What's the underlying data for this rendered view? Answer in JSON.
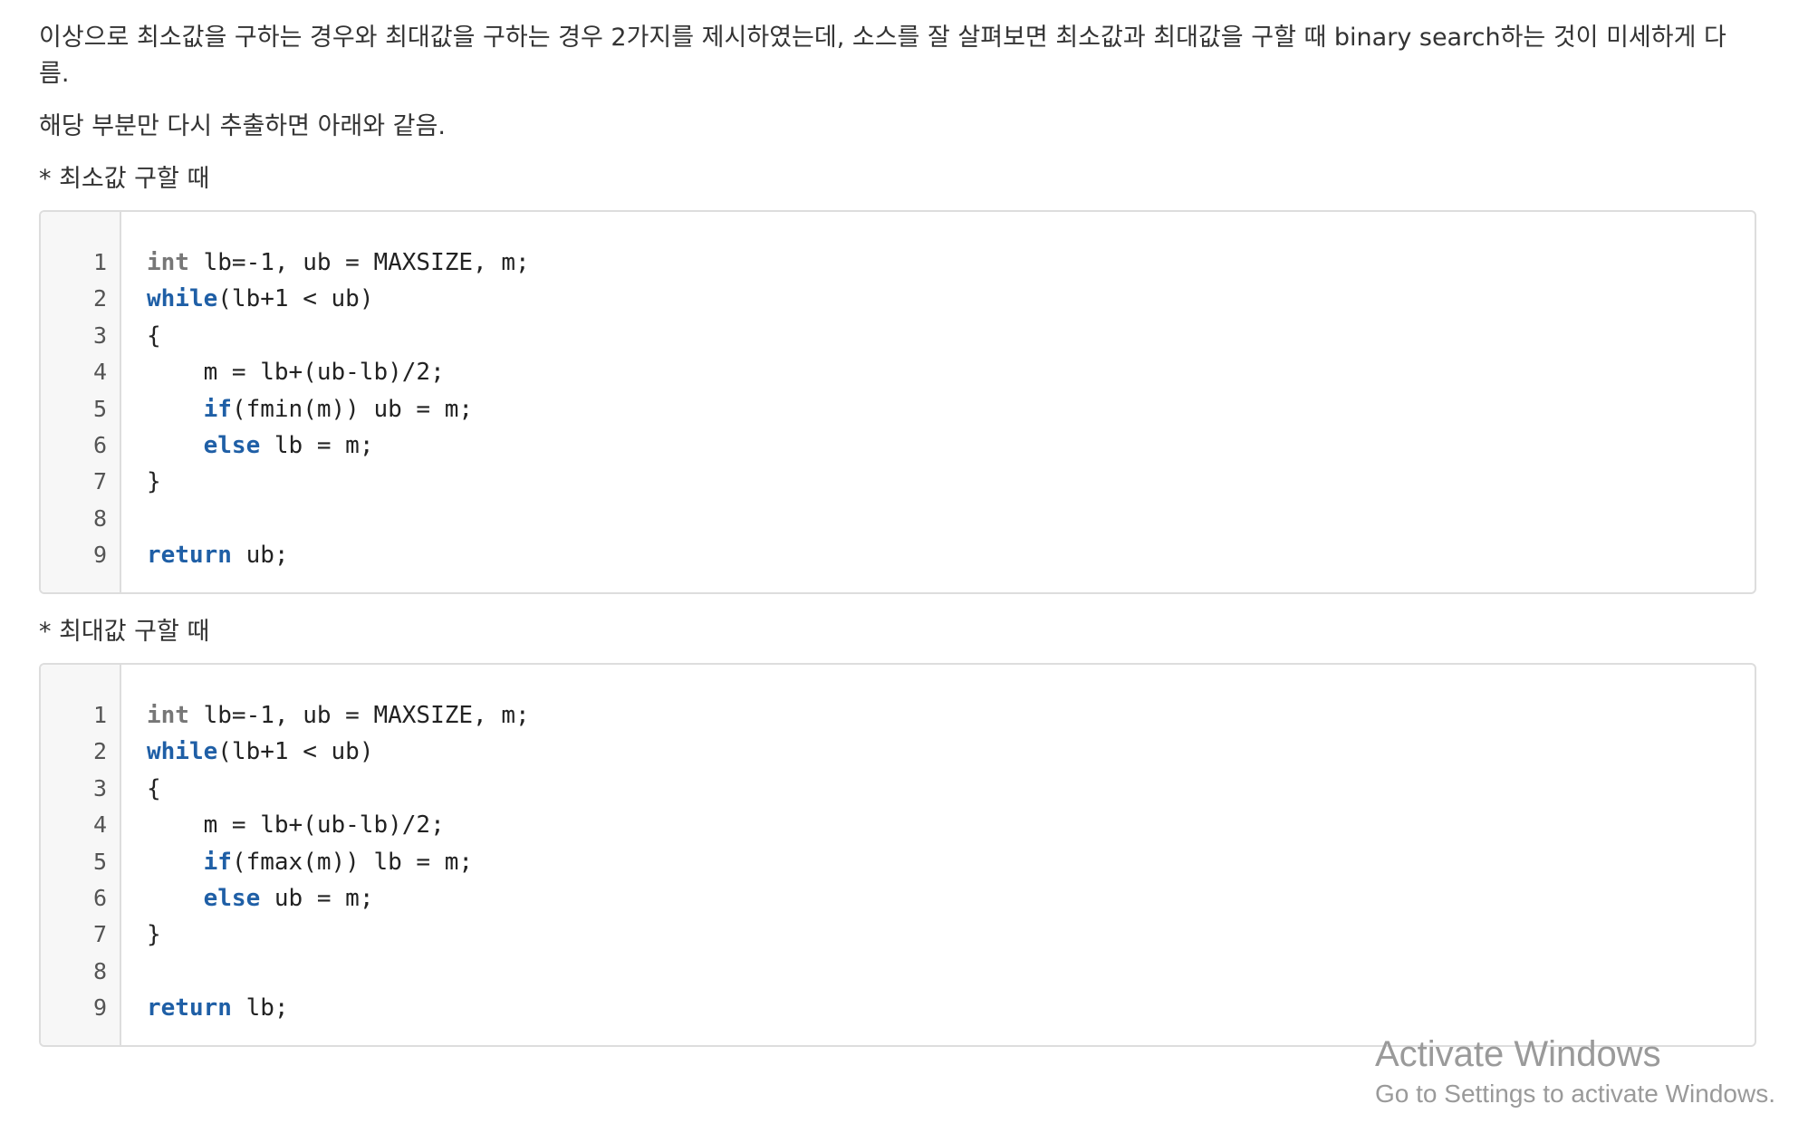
{
  "intro": "이상으로 최소값을 구하는 경우와 최대값을 구하는 경우 2가지를 제시하였는데, 소스를 잘 살펴보면 최소값과 최대값을 구할 때 binary search하는 것이 미세하게 다름.",
  "extract_note": "해당 부분만 다시 추출하면 아래와 같음.",
  "blocks": [
    {
      "label": "* 최소값 구할 때",
      "line_numbers": [
        "1",
        "2",
        "3",
        "4",
        "5",
        "6",
        "7",
        "8",
        "9"
      ],
      "lines": [
        [
          {
            "t": "int",
            "c": "kw-type"
          },
          {
            "t": " lb=-1, ub = MAXSIZE, m;"
          }
        ],
        [
          {
            "t": "while",
            "c": "kw"
          },
          {
            "t": "(lb+1 < ub)"
          }
        ],
        [
          {
            "t": "{"
          }
        ],
        [
          {
            "t": "    m = lb+(ub-lb)/2;"
          }
        ],
        [
          {
            "t": "    "
          },
          {
            "t": "if",
            "c": "kw"
          },
          {
            "t": "(fmin(m)) ub = m;"
          }
        ],
        [
          {
            "t": "    "
          },
          {
            "t": "else",
            "c": "kw"
          },
          {
            "t": " lb = m;"
          }
        ],
        [
          {
            "t": "}"
          }
        ],
        [
          {
            "t": ""
          }
        ],
        [
          {
            "t": "return",
            "c": "kw"
          },
          {
            "t": " ub;"
          }
        ]
      ]
    },
    {
      "label": "* 최대값 구할 때",
      "line_numbers": [
        "1",
        "2",
        "3",
        "4",
        "5",
        "6",
        "7",
        "8",
        "9"
      ],
      "lines": [
        [
          {
            "t": "int",
            "c": "kw-type"
          },
          {
            "t": " lb=-1, ub = MAXSIZE, m;"
          }
        ],
        [
          {
            "t": "while",
            "c": "kw"
          },
          {
            "t": "(lb+1 < ub)"
          }
        ],
        [
          {
            "t": "{"
          }
        ],
        [
          {
            "t": "    m = lb+(ub-lb)/2;"
          }
        ],
        [
          {
            "t": "    "
          },
          {
            "t": "if",
            "c": "kw"
          },
          {
            "t": "(fmax(m)) lb = m;"
          }
        ],
        [
          {
            "t": "    "
          },
          {
            "t": "else",
            "c": "kw"
          },
          {
            "t": " ub = m;"
          }
        ],
        [
          {
            "t": "}"
          }
        ],
        [
          {
            "t": ""
          }
        ],
        [
          {
            "t": "return",
            "c": "kw"
          },
          {
            "t": " lb;"
          }
        ]
      ]
    }
  ],
  "watermark": {
    "title": "Activate Windows",
    "subtitle": "Go to Settings to activate Windows."
  }
}
